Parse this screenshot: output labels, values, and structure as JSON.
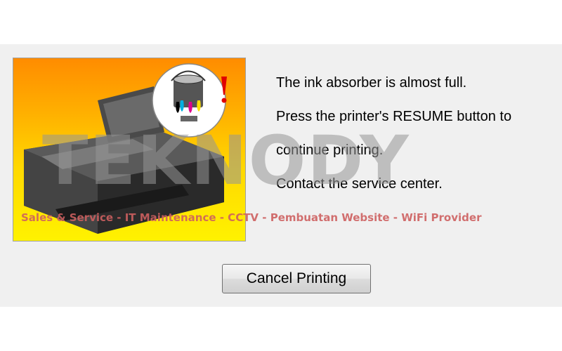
{
  "dialog": {
    "message_lines": [
      "The ink absorber is almost full.",
      "Press the printer's RESUME button to",
      "continue printing.",
      "Contact the service center."
    ],
    "cancel_label": "Cancel Printing"
  },
  "watermark": {
    "brand": "TEKNODY",
    "tagline": "Sales & Service - IT Maintenance - CCTV - Pembuatan Website - WiFi Provider"
  },
  "colors": {
    "dialog_bg": "#f0f0f0",
    "illustration_gradient_top": "#ff8c00",
    "illustration_gradient_bottom": "#fff200",
    "warning_accent": "#e00000",
    "ink_cyan": "#00b0e0",
    "ink_magenta": "#e0008c",
    "ink_yellow": "#ffe000",
    "ink_black": "#000000"
  },
  "icons": {
    "printer": "printer-icon",
    "ink_bucket": "ink-bucket-icon",
    "warning": "exclamation-icon"
  }
}
